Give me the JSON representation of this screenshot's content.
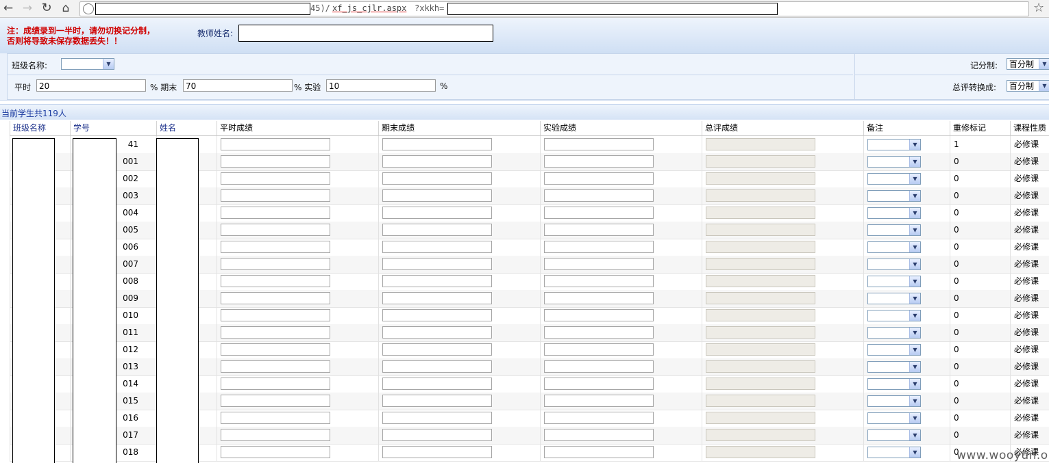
{
  "browser": {
    "url_fragment": "45)/",
    "url_page": "xf_js_cjlr.aspx",
    "url_query": "?xkkh="
  },
  "header": {
    "warning_line1": "注：成绩录到一半时，请勿切换记分制，",
    "warning_line2": "否则将导致未保存数据丢失！！",
    "teacher_label": "教师姓名:"
  },
  "settings": {
    "class_label": "班级名称:",
    "scoring_label": "记分制:",
    "scoring_value": "百分制",
    "convert_label": "总评转换成:",
    "convert_value": "百分制",
    "regular_label": "平时",
    "regular_value": "20",
    "final_label": "% 期末",
    "final_value": "70",
    "lab_label": "% 实验",
    "lab_value": "10",
    "pct_suffix": "%"
  },
  "count_text": "当前学生共119人",
  "table": {
    "headers": [
      "班级名称",
      "学号",
      "姓名",
      "平时成绩",
      "期末成绩",
      "实验成绩",
      "总评成绩",
      "备注",
      "重修标记",
      "课程性质"
    ],
    "rows": [
      {
        "id_suffix": "41",
        "retake": "1",
        "nature": "必修课"
      },
      {
        "id_suffix": "001",
        "retake": "0",
        "nature": "必修课"
      },
      {
        "id_suffix": "002",
        "retake": "0",
        "nature": "必修课"
      },
      {
        "id_suffix": "003",
        "retake": "0",
        "nature": "必修课"
      },
      {
        "id_suffix": "004",
        "retake": "0",
        "nature": "必修课"
      },
      {
        "id_suffix": "005",
        "retake": "0",
        "nature": "必修课"
      },
      {
        "id_suffix": "006",
        "retake": "0",
        "nature": "必修课"
      },
      {
        "id_suffix": "007",
        "retake": "0",
        "nature": "必修课"
      },
      {
        "id_suffix": "008",
        "retake": "0",
        "nature": "必修课"
      },
      {
        "id_suffix": "009",
        "retake": "0",
        "nature": "必修课"
      },
      {
        "id_suffix": "010",
        "retake": "0",
        "nature": "必修课"
      },
      {
        "id_suffix": "011",
        "retake": "0",
        "nature": "必修课"
      },
      {
        "id_suffix": "012",
        "retake": "0",
        "nature": "必修课"
      },
      {
        "id_suffix": "013",
        "retake": "0",
        "nature": "必修课"
      },
      {
        "id_suffix": "014",
        "retake": "0",
        "nature": "必修课"
      },
      {
        "id_suffix": "015",
        "retake": "0",
        "nature": "必修课"
      },
      {
        "id_suffix": "016",
        "retake": "0",
        "nature": "必修课"
      },
      {
        "id_suffix": "017",
        "retake": "0",
        "nature": "必修课"
      },
      {
        "id_suffix": "018",
        "retake": "0",
        "nature": "必修课"
      }
    ]
  },
  "watermark": "www.wooyun.org"
}
